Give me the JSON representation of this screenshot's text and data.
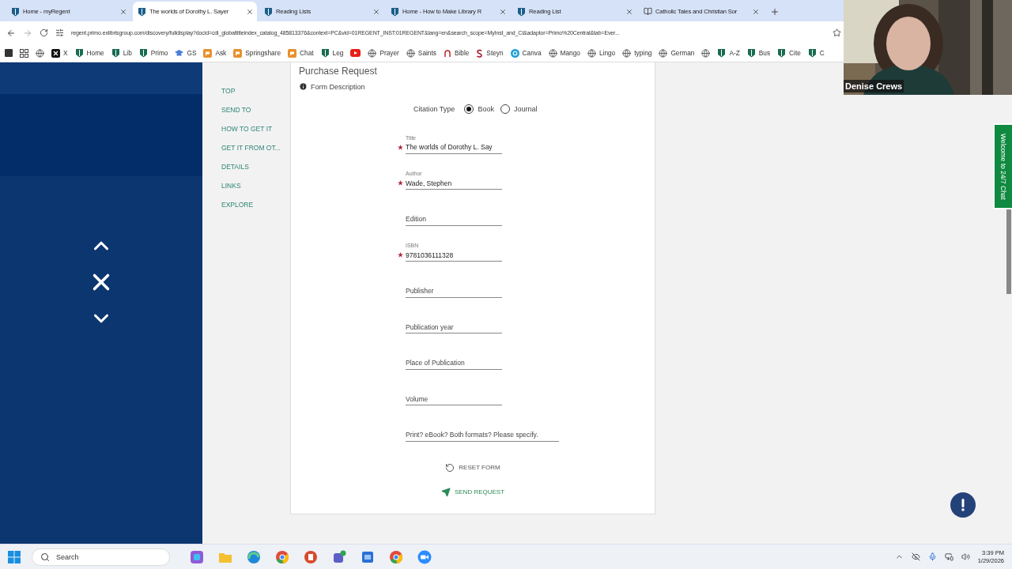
{
  "browser": {
    "tabs": [
      {
        "title": "Home - myRegent",
        "kind": "shield",
        "selected": false
      },
      {
        "title": "The worlds of Dorothy L. Sayer",
        "kind": "shield",
        "selected": true
      },
      {
        "title": "Reading Lists",
        "kind": "shield",
        "selected": false
      },
      {
        "title": "Home - How to Make Library R",
        "kind": "shield",
        "selected": false
      },
      {
        "title": "Reading List",
        "kind": "shield",
        "selected": false
      },
      {
        "title": "Catholic Tales and Christian Sor",
        "kind": "book",
        "selected": false
      }
    ],
    "address": "regent.primo.exlibrisgroup.com/discovery/fulldisplay?docid=cdi_globaltitleindex_catalog_485813376&context=PC&vid=01REGENT_INST:01REGENT&lang=en&search_scope=MyInst_and_CI&adaptor=Primo%20Central&tab=Ever...",
    "bookmarks": [
      {
        "kind": "stop"
      },
      {
        "kind": "apps"
      },
      {
        "kind": "globe"
      },
      {
        "kind": "x",
        "label": "X"
      },
      {
        "kind": "shield",
        "label": "Home"
      },
      {
        "kind": "shield",
        "label": "Lib"
      },
      {
        "kind": "shield",
        "label": "Primo"
      },
      {
        "kind": "cap",
        "label": "GS"
      },
      {
        "kind": "chat",
        "label": "Ask"
      },
      {
        "kind": "chat",
        "label": "Springshare"
      },
      {
        "kind": "chat",
        "label": "Chat"
      },
      {
        "kind": "shield",
        "label": "Leg"
      },
      {
        "kind": "youtube"
      },
      {
        "kind": "globe",
        "label": "Prayer"
      },
      {
        "kind": "globe",
        "label": "Saints"
      },
      {
        "kind": "arc",
        "label": "Bible"
      },
      {
        "kind": "letter",
        "label": "Steyn"
      },
      {
        "kind": "canva",
        "label": "Canva"
      },
      {
        "kind": "globe",
        "label": "Mango"
      },
      {
        "kind": "globe",
        "label": "Lingo"
      },
      {
        "kind": "globe",
        "label": "typing"
      },
      {
        "kind": "globe",
        "label": "German"
      },
      {
        "kind": "globe"
      },
      {
        "kind": "shield",
        "label": "A-Z"
      },
      {
        "kind": "shield",
        "label": "Bus"
      },
      {
        "kind": "shield",
        "label": "Cite"
      },
      {
        "kind": "shield",
        "label": "C"
      }
    ]
  },
  "record_nav": [
    "TOP",
    "SEND TO",
    "HOW TO GET IT",
    "GET IT FROM OT...",
    "DETAILS",
    "LINKS",
    "EXPLORE"
  ],
  "form": {
    "title": "Purchase Request",
    "description_link": "Form Description",
    "citation_type": {
      "label": "Citation Type",
      "options": [
        {
          "label": "Book",
          "selected": true
        },
        {
          "label": "Journal",
          "selected": false
        }
      ]
    },
    "fields": [
      {
        "label": "Title",
        "value": "The worlds of Dorothy L. Say",
        "required": true
      },
      {
        "label": "Author",
        "value": "Wade, Stephen",
        "required": true
      },
      {
        "placeholder": "Edition",
        "required": false
      },
      {
        "label": "ISBN",
        "value": "9781036111328",
        "required": true
      },
      {
        "placeholder": "Publisher",
        "required": false
      },
      {
        "placeholder": "Publication year",
        "required": false
      },
      {
        "placeholder": "Place of Publication",
        "required": false
      },
      {
        "placeholder": "Volume",
        "required": false
      },
      {
        "placeholder": "Print? eBook? Both formats? Please specify.",
        "required": false
      }
    ],
    "buttons": [
      {
        "kind": "reset",
        "label": "RESET FORM"
      },
      {
        "kind": "send",
        "label": "SEND REQUEST"
      }
    ]
  },
  "chat_tab": "Welcome to 24/7 Chat",
  "video": {
    "name": "Denise Crews"
  },
  "taskbar": {
    "search": {
      "placeholder": "Search"
    },
    "time": "3:39 PM",
    "date": "1/29/2026"
  }
}
